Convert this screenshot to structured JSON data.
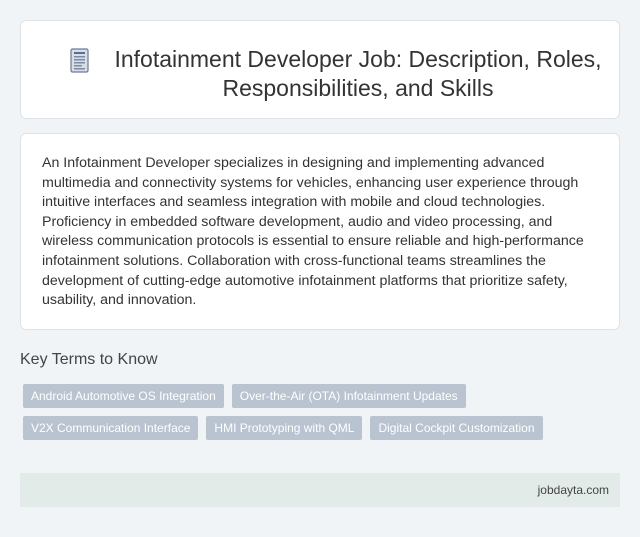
{
  "header": {
    "icon": "document-icon",
    "title": "Infotainment Developer Job: Description, Roles, Responsibilities, and Skills"
  },
  "description": {
    "text": "An Infotainment Developer specializes in designing and implementing advanced multimedia and connectivity systems for vehicles, enhancing user experience through intuitive interfaces and seamless integration with mobile and cloud technologies. Proficiency in embedded software development, audio and video processing, and wireless communication protocols is essential to ensure reliable and high-performance infotainment solutions. Collaboration with cross-functional teams streamlines the development of cutting-edge automotive infotainment platforms that prioritize safety, usability, and innovation."
  },
  "key_terms": {
    "heading": "Key Terms to Know",
    "tags": [
      "Android Automotive OS Integration",
      "Over-the-Air (OTA) Infotainment Updates",
      "V2X Communication Interface",
      "HMI Prototyping with QML",
      "Digital Cockpit Customization"
    ]
  },
  "footer": {
    "site": "jobdayta.com"
  },
  "colors": {
    "background": "#f0f4f7",
    "card": "#ffffff",
    "tag_bg": "#b9c4d0",
    "footer_bg": "#e3ebe9"
  }
}
